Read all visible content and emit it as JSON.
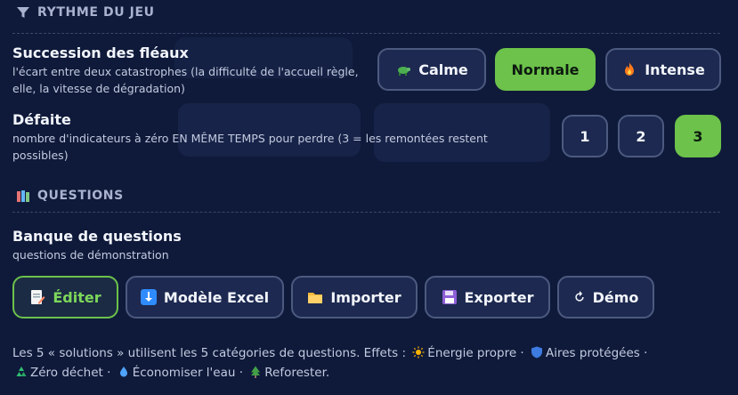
{
  "sections": {
    "rythme": {
      "title": "RYTHME DU JEU",
      "icon": "funnel-icon"
    },
    "questions": {
      "title": "QUESTIONS",
      "icon": "books-icon"
    }
  },
  "succession": {
    "title": "Succession des fléaux",
    "description": "l'écart entre deux catastrophes (la difficulté de l'accueil règle, elle, la vitesse de dégradation)",
    "options": [
      {
        "label": "Calme",
        "icon": "turtle-icon",
        "selected": false
      },
      {
        "label": "Normale",
        "icon": "",
        "selected": true
      },
      {
        "label": "Intense",
        "icon": "fire-icon",
        "selected": false
      }
    ]
  },
  "defaite": {
    "title": "Défaite",
    "description": "nombre d'indicateurs à zéro EN MÊME TEMPS pour perdre (3 = les remontées restent possibles)",
    "options": [
      {
        "label": "1",
        "selected": false
      },
      {
        "label": "2",
        "selected": false
      },
      {
        "label": "3",
        "selected": true
      }
    ]
  },
  "banque": {
    "title": "Banque de questions",
    "description": "questions de démonstration",
    "actions": [
      {
        "label": "Éditer",
        "icon": "memo-icon"
      },
      {
        "label": "Modèle Excel",
        "icon": "download-icon"
      },
      {
        "label": "Importer",
        "icon": "folder-icon"
      },
      {
        "label": "Exporter",
        "icon": "floppy-disk-icon"
      },
      {
        "label": "Démo",
        "icon": "refresh-icon"
      }
    ]
  },
  "footer": {
    "intro": "Les 5 « solutions » utilisent les 5 catégories de questions. Effets :",
    "items": [
      {
        "icon": "sun-icon",
        "label": "Énergie propre"
      },
      {
        "icon": "shield-icon",
        "label": "Aires protégées"
      },
      {
        "icon": "recycle-icon",
        "label": "Zéro déchet"
      },
      {
        "icon": "droplet-icon",
        "label": "Économiser l'eau"
      },
      {
        "icon": "tree-icon",
        "label": "Reforester."
      }
    ]
  },
  "colors": {
    "background": "#0f1a3a",
    "accent": "#6cc24a",
    "button": "#1d2950",
    "border": "#4d5a80"
  }
}
